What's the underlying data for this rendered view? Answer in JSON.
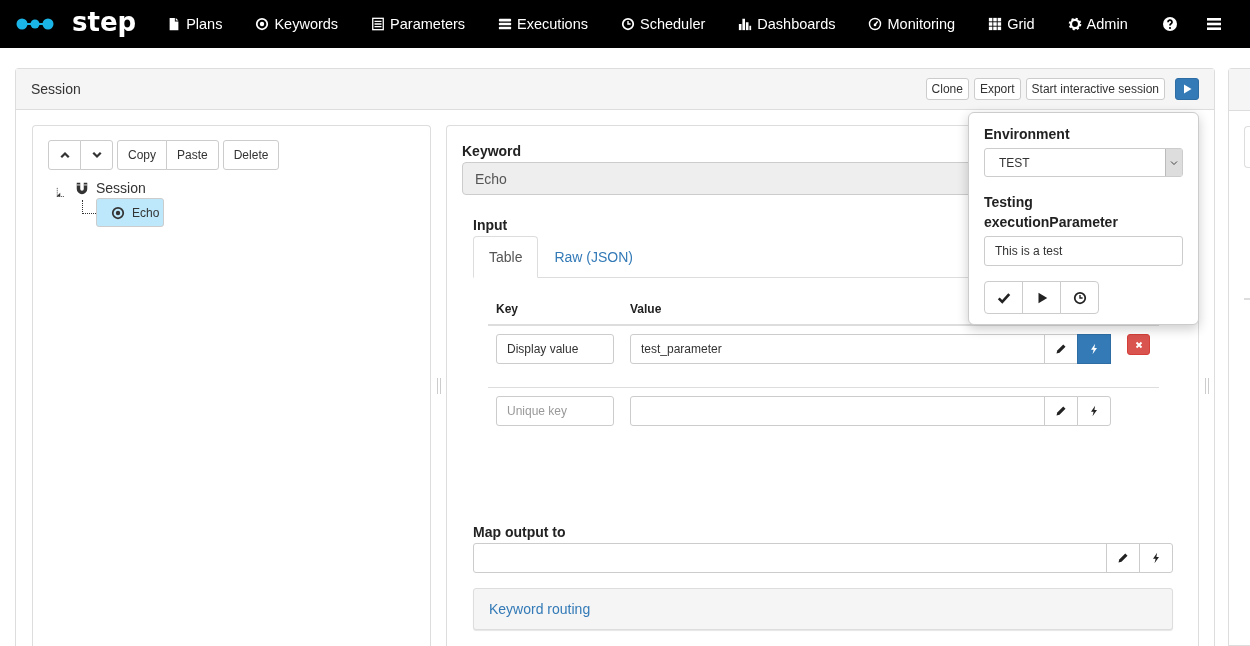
{
  "navbar": {
    "logo": "step",
    "items": [
      {
        "label": "Plans"
      },
      {
        "label": "Keywords"
      },
      {
        "label": "Parameters"
      },
      {
        "label": "Executions"
      },
      {
        "label": "Scheduler"
      },
      {
        "label": "Dashboards"
      },
      {
        "label": "Monitoring"
      },
      {
        "label": "Grid"
      },
      {
        "label": "Admin"
      }
    ]
  },
  "session": {
    "title": "Session",
    "actions": [
      "Clone",
      "Export",
      "Start interactive session"
    ],
    "tree_toolbar": {
      "edit_buttons": [
        "Copy",
        "Paste"
      ],
      "delete_button": "Delete"
    },
    "tree": [
      {
        "label": "Session",
        "kind": "session",
        "selected": false,
        "expanded": true,
        "children": [
          {
            "label": "Echo",
            "kind": "keyword",
            "selected": true
          }
        ]
      }
    ]
  },
  "editor": {
    "keyword_label": "Keyword",
    "keyword_value": "Echo",
    "input": {
      "label": "Input",
      "tabs": [
        {
          "label": "Table",
          "selected": true
        },
        {
          "label": "Raw (JSON)",
          "selected": false
        }
      ],
      "columns": [
        "Key",
        "Value"
      ],
      "rows": [
        {
          "key": "Display value",
          "value": "test_parameter",
          "dynamic": true,
          "deletable": true
        },
        {
          "key_placeholder": "Unique key",
          "dynamic": false,
          "deletable": false
        }
      ]
    },
    "map_output_label": "Map output to",
    "routing": "Keyword routing"
  },
  "popover": {
    "environment_label": "Environment",
    "environment_value": "TEST",
    "parameter_label": "Testing executionParameter",
    "parameter_value": "This is a test"
  }
}
